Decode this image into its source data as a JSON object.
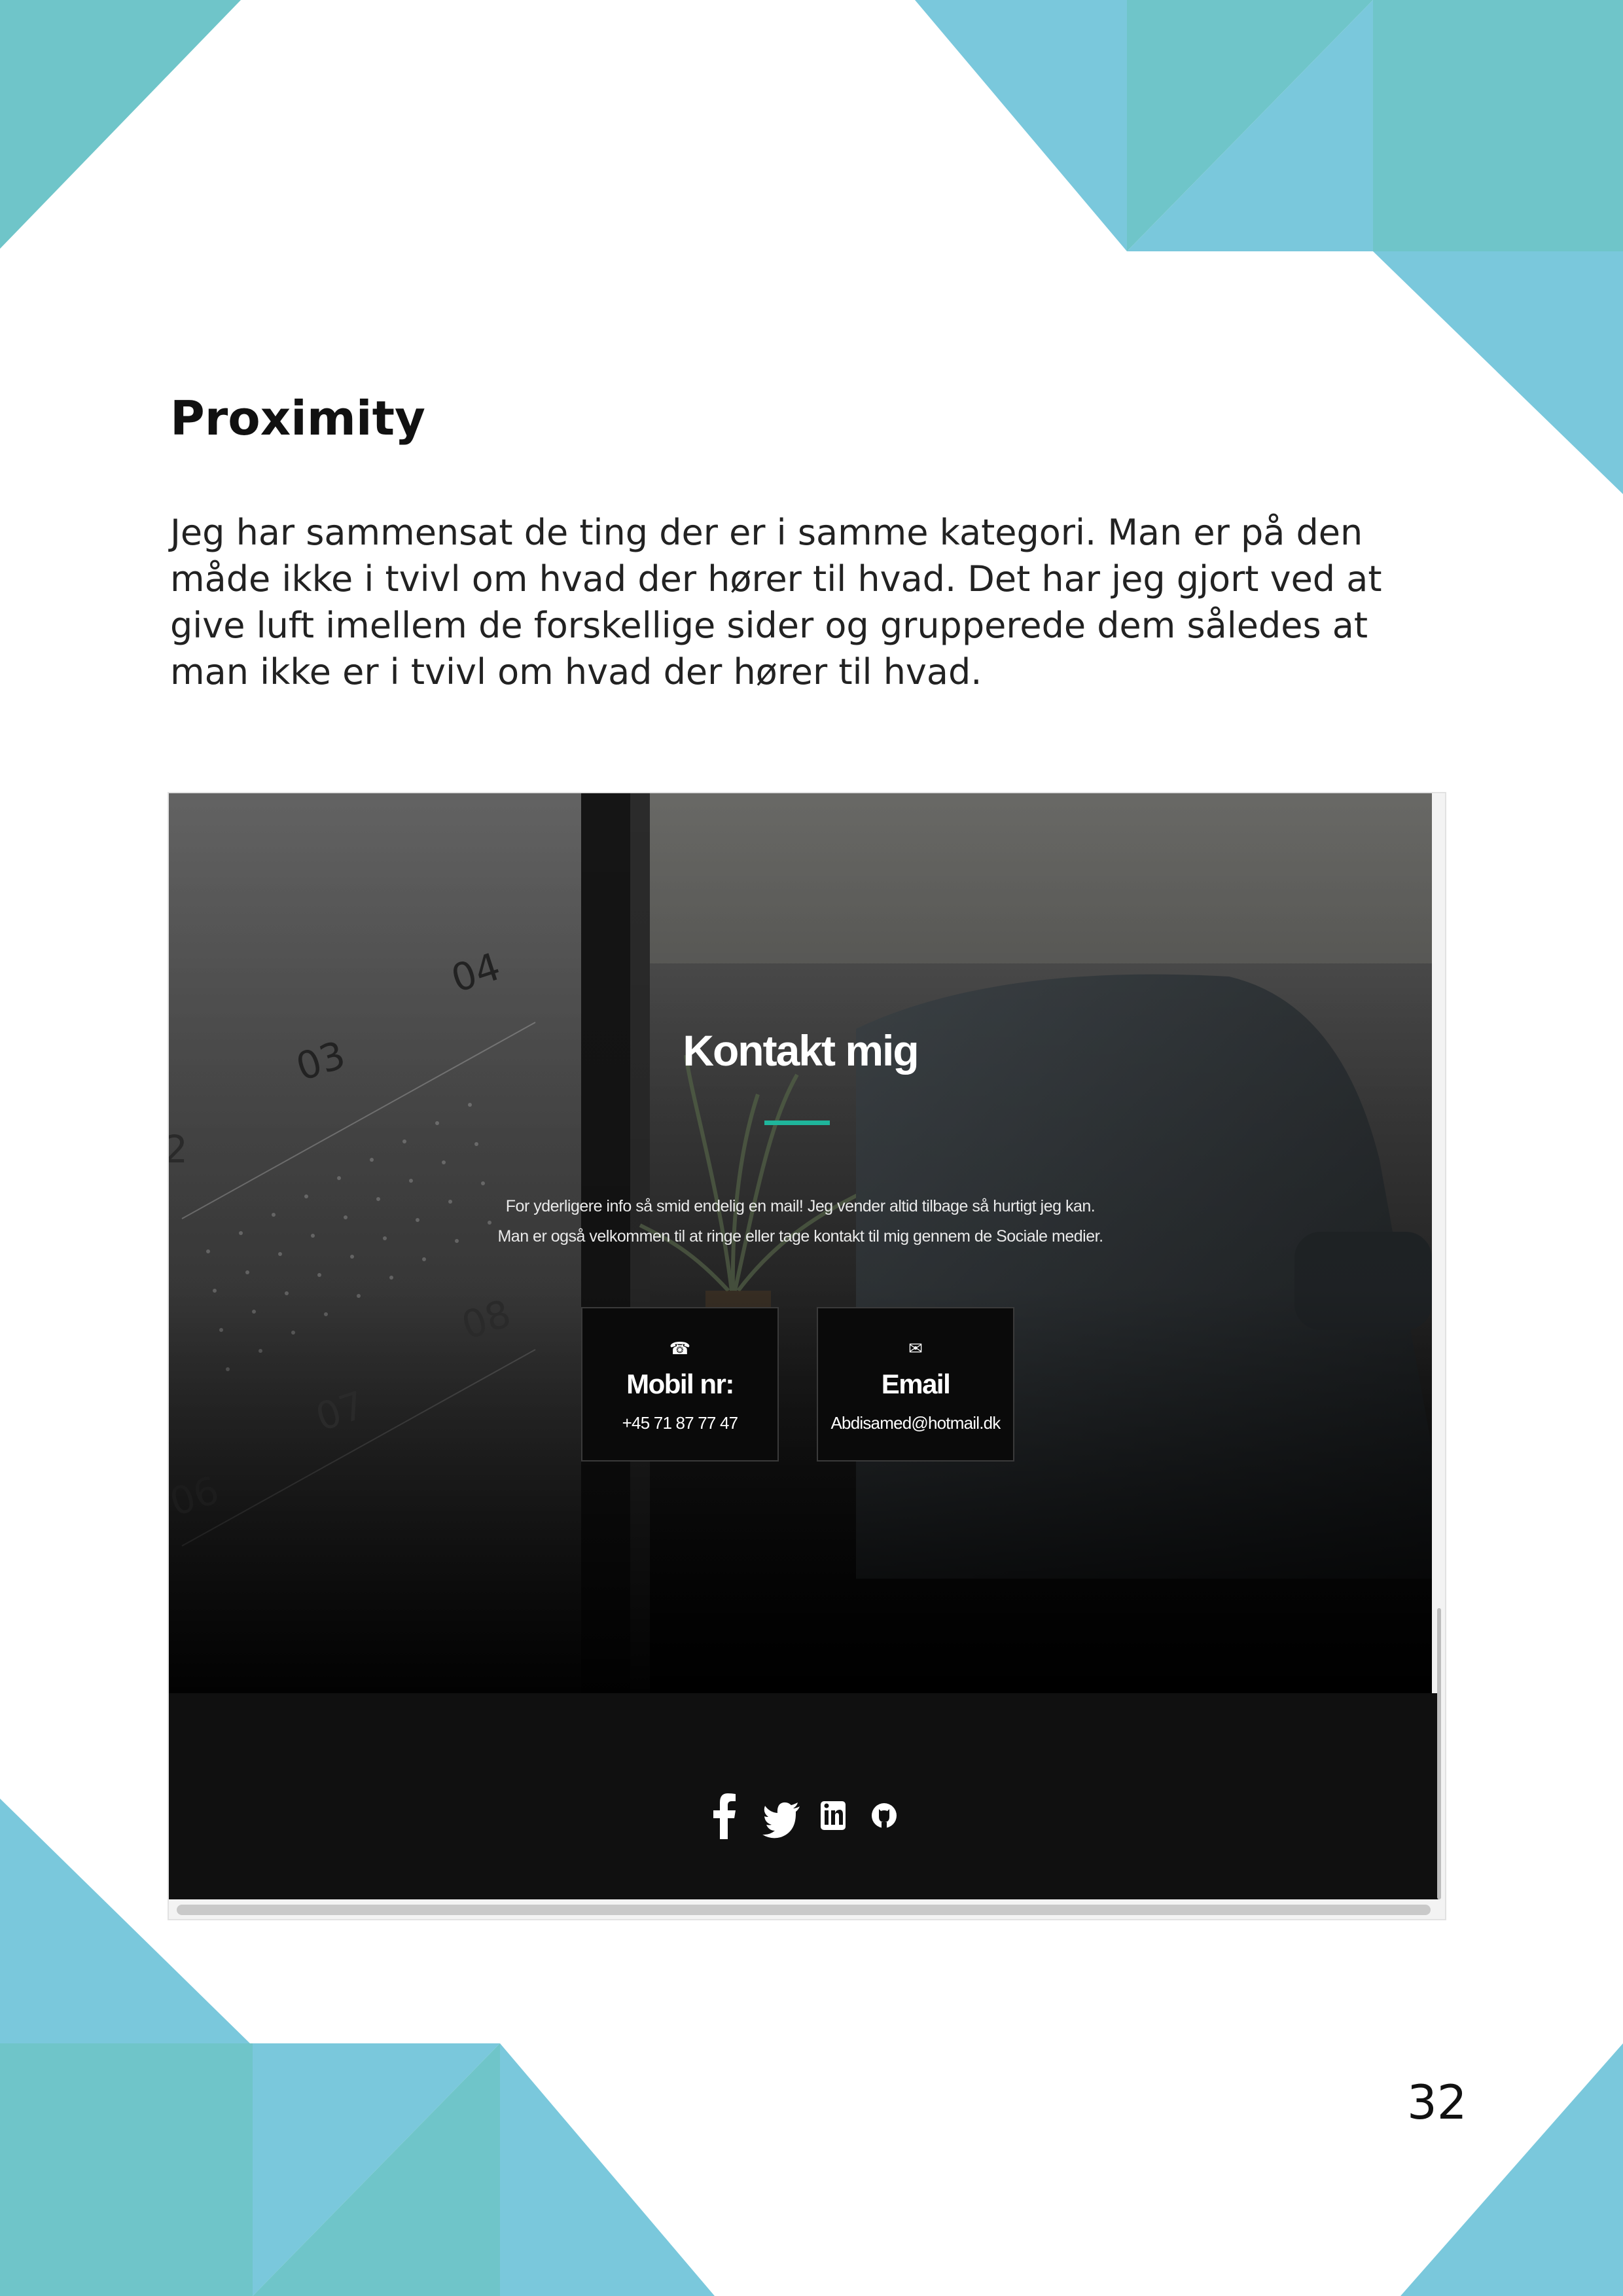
{
  "page": {
    "heading": "Proximity",
    "body_lines": [
      "Jeg har sammensat de ting der er i samme kategori. Man er på den",
      "måde ikke i tvivl om hvad der hører til hvad. Det har jeg gjort ved at",
      "give luft imellem de forskellige sider og grupperede dem således at",
      "man ikke er i tvivl om hvad der hører til hvad."
    ],
    "page_number": "32"
  },
  "screenshot": {
    "calendar_numbers": [
      "04",
      "03",
      "08",
      "07",
      "06",
      "2"
    ],
    "title": "Kontakt mig",
    "description_lines": [
      "For yderligere info så smid endelig en mail! Jeg vender altid tilbage så hurtigt jeg kan.",
      "Man er også velkommen til at ringe eller tage kontakt til mig gennem de Sociale medier."
    ],
    "cards": [
      {
        "icon": "phone-icon",
        "glyph": "☎",
        "title": "Mobil nr:",
        "value": "+45 71 87 77 47"
      },
      {
        "icon": "envelope-icon",
        "glyph": "✉",
        "title": "Email",
        "value": "Abdisamed@hotmail.dk"
      }
    ],
    "social_icons": [
      "facebook-icon",
      "twitter-icon",
      "linkedin-icon",
      "github-icon"
    ]
  },
  "colors": {
    "deco_teal": "#6fc5c9",
    "deco_blue": "#7ac8dc",
    "accent": "#1fb59b",
    "footer_bg": "#101010"
  }
}
